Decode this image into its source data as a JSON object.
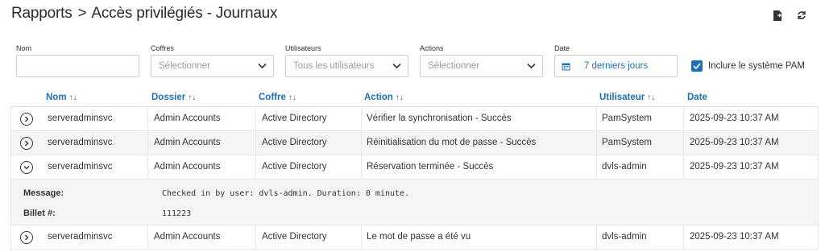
{
  "header": {
    "breadcrumb_root": "Rapports",
    "breadcrumb_sep": ">",
    "title": "Accès privilégiés - Journaux",
    "icons": [
      "export-icon",
      "refresh-icon"
    ]
  },
  "filters": {
    "name": {
      "label": "Nom",
      "value": ""
    },
    "vaults": {
      "label": "Coffres",
      "placeholder": "Sélectionner"
    },
    "users": {
      "label": "Utilisateurs",
      "placeholder": "Tous les utilisateurs"
    },
    "actions": {
      "label": "Actions",
      "placeholder": "Sélectionner"
    },
    "date": {
      "label": "Date",
      "value": "7 derniers jours"
    },
    "include_pam": {
      "label": "Inclure le système PAM",
      "checked": true
    }
  },
  "table": {
    "columns": [
      {
        "key": "name",
        "label": "Nom",
        "sortable": true
      },
      {
        "key": "folder",
        "label": "Dossier",
        "sortable": true
      },
      {
        "key": "vault",
        "label": "Coffre",
        "sortable": true
      },
      {
        "key": "action",
        "label": "Action",
        "sortable": true
      },
      {
        "key": "user",
        "label": "Utilisateur",
        "sortable": true
      },
      {
        "key": "date",
        "label": "Date",
        "sortable": false
      }
    ],
    "sort_glyph": "↑↓",
    "rows": [
      {
        "name": "serveradminsvc",
        "folder": "Admin Accounts",
        "vault": "Active Directory",
        "action": "Vérifier la synchronisation - Succès",
        "user": "PamSystem",
        "date": "2025-09-23 10:37 AM",
        "expanded": false
      },
      {
        "name": "serveradminsvc",
        "folder": "Admin Accounts",
        "vault": "Active Directory",
        "action": "Réinitialisation du mot de passe - Succès",
        "user": "PamSystem",
        "date": "2025-09-23 10:37 AM",
        "expanded": false
      },
      {
        "name": "serveradminsvc",
        "folder": "Admin Accounts",
        "vault": "Active Directory",
        "action": "Réservation terminée - Succès",
        "user": "dvls-admin",
        "date": "2025-09-23 10:37 AM",
        "expanded": true
      },
      {
        "name": "serveradminsvc",
        "folder": "Admin Accounts",
        "vault": "Active Directory",
        "action": "Le mot de passe a été vu",
        "user": "dvls-admin",
        "date": "2025-09-23 10:37 AM",
        "expanded": false
      }
    ],
    "detail": {
      "message_label": "Message:",
      "message_value": "Checked in by user: dvls-admin. Duration: 0 minute.",
      "ticket_label": "Billet #:",
      "ticket_value": "111223"
    }
  },
  "colors": {
    "accent": "#1f6fb5",
    "row_alt": "#f3f5f7",
    "border": "#e4e7ea"
  }
}
